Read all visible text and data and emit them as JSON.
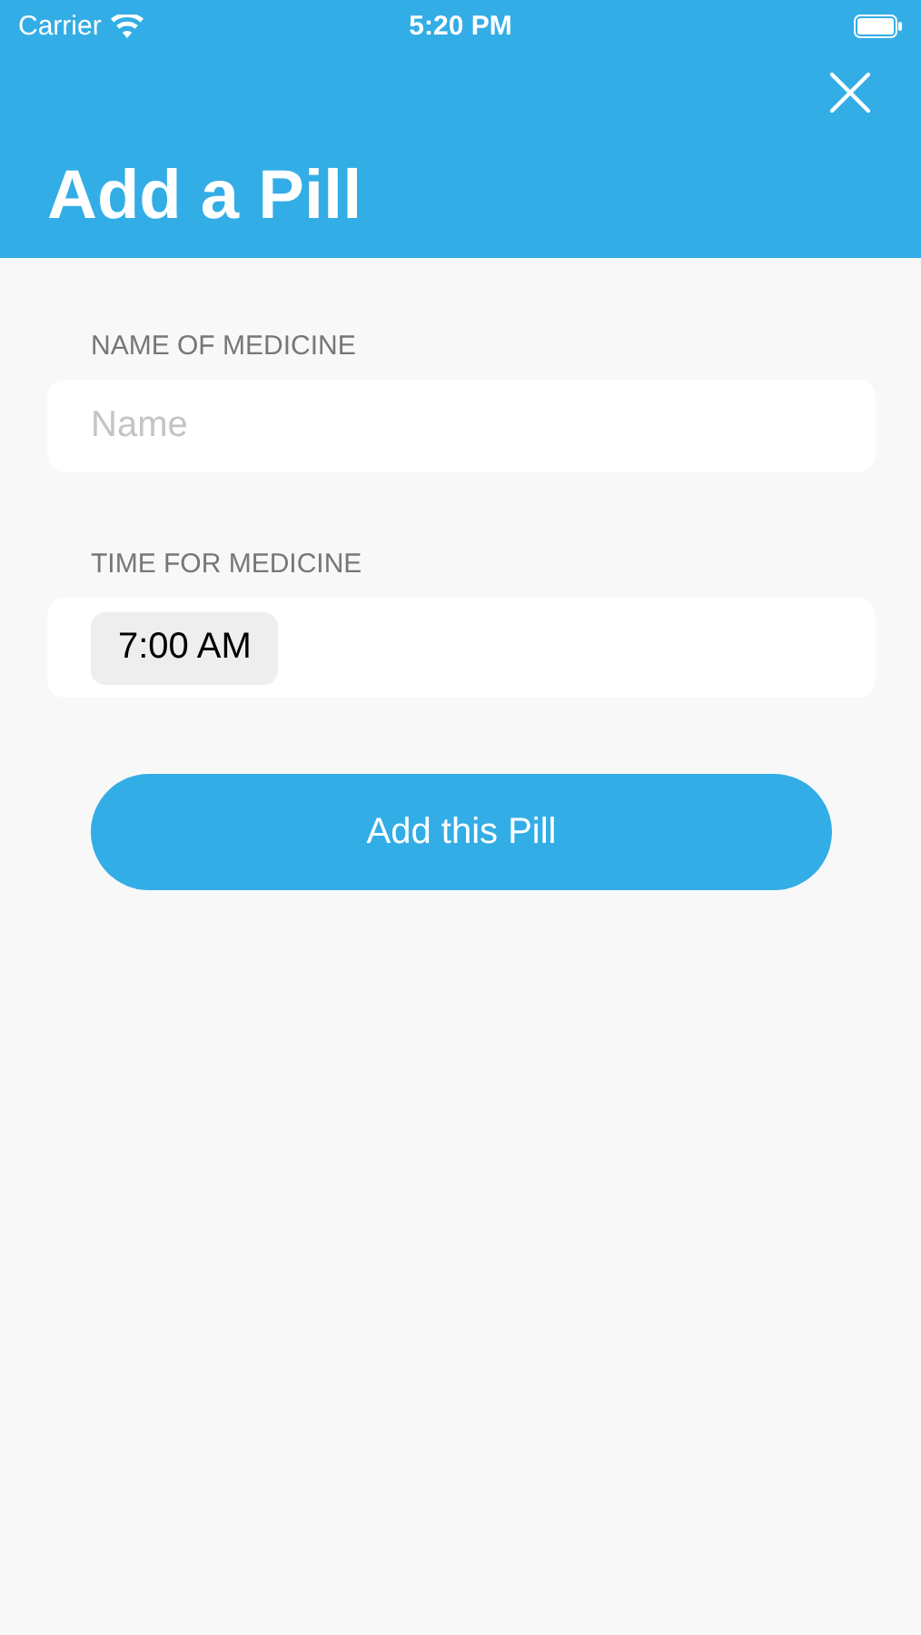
{
  "status_bar": {
    "carrier": "Carrier",
    "time": "5:20 PM"
  },
  "header": {
    "title": "Add a Pill"
  },
  "fields": [
    {
      "kind": "text",
      "label": "NAME OF MEDICINE",
      "placeholder": "Name"
    },
    {
      "kind": "time",
      "label": "TIME FOR MEDICINE",
      "value": "7:00 AM"
    }
  ],
  "submit_button": {
    "label": "Add this Pill"
  }
}
